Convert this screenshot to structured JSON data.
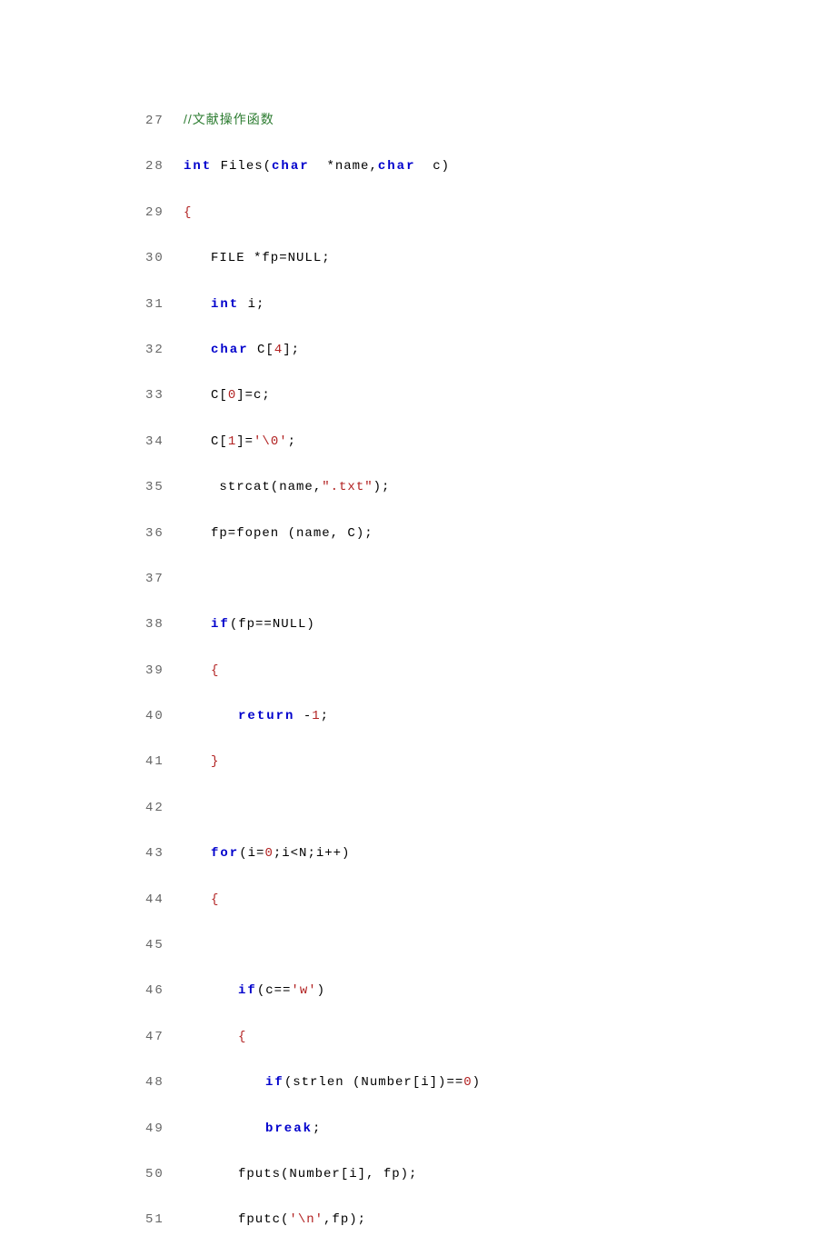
{
  "lines": [
    {
      "no": "27",
      "indent": 0,
      "tokens": [
        {
          "cls": "comment",
          "t": "//文献操作函数"
        }
      ]
    },
    {
      "no": "28",
      "indent": 0,
      "tokens": [
        {
          "cls": "keyword",
          "t": "int"
        },
        {
          "cls": "ident",
          "t": " Files("
        },
        {
          "cls": "keyword",
          "t": "char"
        },
        {
          "cls": "ident",
          "t": "  *name,"
        },
        {
          "cls": "keyword",
          "t": "char"
        },
        {
          "cls": "ident",
          "t": "  c)"
        }
      ]
    },
    {
      "no": "29",
      "indent": 0,
      "tokens": [
        {
          "cls": "brace",
          "t": "{"
        }
      ]
    },
    {
      "no": "30",
      "indent": 1,
      "tokens": [
        {
          "cls": "ident",
          "t": "FILE *fp=NULL;"
        }
      ]
    },
    {
      "no": "31",
      "indent": 1,
      "tokens": [
        {
          "cls": "keyword",
          "t": "int"
        },
        {
          "cls": "ident",
          "t": " i;"
        }
      ]
    },
    {
      "no": "32",
      "indent": 1,
      "tokens": [
        {
          "cls": "keyword",
          "t": "char"
        },
        {
          "cls": "ident",
          "t": " C["
        },
        {
          "cls": "num",
          "t": "4"
        },
        {
          "cls": "ident",
          "t": "];"
        }
      ]
    },
    {
      "no": "33",
      "indent": 1,
      "tokens": [
        {
          "cls": "ident",
          "t": "C["
        },
        {
          "cls": "num",
          "t": "0"
        },
        {
          "cls": "ident",
          "t": "]=c;"
        }
      ]
    },
    {
      "no": "34",
      "indent": 1,
      "tokens": [
        {
          "cls": "ident",
          "t": "C["
        },
        {
          "cls": "num",
          "t": "1"
        },
        {
          "cls": "ident",
          "t": "]="
        },
        {
          "cls": "charlit",
          "t": "'\\0'"
        },
        {
          "cls": "ident",
          "t": ";"
        }
      ]
    },
    {
      "no": "35",
      "indent": 1,
      "tokens": [
        {
          "cls": "ident",
          "t": " strcat(name,"
        },
        {
          "cls": "str",
          "t": "\".txt\""
        },
        {
          "cls": "ident",
          "t": ");"
        }
      ]
    },
    {
      "no": "36",
      "indent": 1,
      "tokens": [
        {
          "cls": "ident",
          "t": "fp=fopen (name, C);"
        }
      ]
    },
    {
      "no": "37",
      "indent": 0,
      "tokens": []
    },
    {
      "no": "38",
      "indent": 1,
      "tokens": [
        {
          "cls": "keyword",
          "t": "if"
        },
        {
          "cls": "ident",
          "t": "(fp==NULL)"
        }
      ]
    },
    {
      "no": "39",
      "indent": 1,
      "tokens": [
        {
          "cls": "brace",
          "t": "{"
        }
      ]
    },
    {
      "no": "40",
      "indent": 2,
      "tokens": [
        {
          "cls": "keyword",
          "t": "return"
        },
        {
          "cls": "ident",
          "t": " -"
        },
        {
          "cls": "num",
          "t": "1"
        },
        {
          "cls": "ident",
          "t": ";"
        }
      ]
    },
    {
      "no": "41",
      "indent": 1,
      "tokens": [
        {
          "cls": "brace",
          "t": "}"
        }
      ]
    },
    {
      "no": "42",
      "indent": 0,
      "tokens": []
    },
    {
      "no": "43",
      "indent": 1,
      "tokens": [
        {
          "cls": "keyword",
          "t": "for"
        },
        {
          "cls": "ident",
          "t": "(i="
        },
        {
          "cls": "num",
          "t": "0"
        },
        {
          "cls": "ident",
          "t": ";i<N;i++)"
        }
      ]
    },
    {
      "no": "44",
      "indent": 1,
      "tokens": [
        {
          "cls": "brace",
          "t": "{"
        }
      ]
    },
    {
      "no": "45",
      "indent": 0,
      "tokens": []
    },
    {
      "no": "46",
      "indent": 2,
      "tokens": [
        {
          "cls": "keyword",
          "t": "if"
        },
        {
          "cls": "ident",
          "t": "(c=="
        },
        {
          "cls": "charlit",
          "t": "'w'"
        },
        {
          "cls": "ident",
          "t": ")"
        }
      ]
    },
    {
      "no": "47",
      "indent": 2,
      "tokens": [
        {
          "cls": "brace",
          "t": "{"
        }
      ]
    },
    {
      "no": "48",
      "indent": 3,
      "tokens": [
        {
          "cls": "keyword",
          "t": "if"
        },
        {
          "cls": "ident",
          "t": "(strlen (Number[i])=="
        },
        {
          "cls": "num",
          "t": "0"
        },
        {
          "cls": "ident",
          "t": ")"
        }
      ]
    },
    {
      "no": "49",
      "indent": 3,
      "tokens": [
        {
          "cls": "keyword",
          "t": "break"
        },
        {
          "cls": "ident",
          "t": ";"
        }
      ]
    },
    {
      "no": "50",
      "indent": 2,
      "tokens": [
        {
          "cls": "ident",
          "t": "fputs(Number[i], fp);"
        }
      ]
    },
    {
      "no": "51",
      "indent": 2,
      "tokens": [
        {
          "cls": "ident",
          "t": "fputc("
        },
        {
          "cls": "charlit",
          "t": "'\\n'"
        },
        {
          "cls": "ident",
          "t": ",fp);"
        }
      ]
    }
  ]
}
